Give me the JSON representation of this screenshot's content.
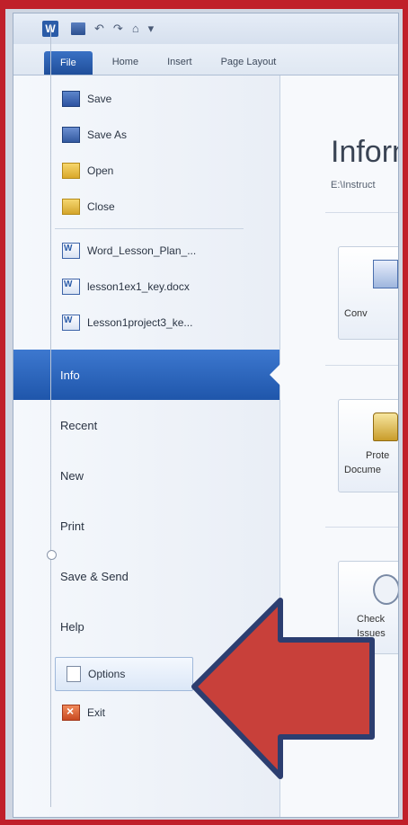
{
  "ribbon": {
    "tabs": [
      "File",
      "Home",
      "Insert",
      "Page Layout"
    ]
  },
  "backstage": {
    "commands": [
      {
        "label": "Save",
        "icon": "save-icon"
      },
      {
        "label": "Save As",
        "icon": "save-as-icon"
      },
      {
        "label": "Open",
        "icon": "open-folder-icon"
      },
      {
        "label": "Close",
        "icon": "close-folder-icon"
      }
    ],
    "recent_files": [
      "Word_Lesson_Plan_...",
      "lesson1ex1_key.docx",
      "Lesson1project3_ke..."
    ],
    "tabs": [
      "Info",
      "Recent",
      "New",
      "Print",
      "Save & Send",
      "Help"
    ],
    "active_tab": "Info",
    "options_label": "Options",
    "exit_label": "Exit"
  },
  "content": {
    "title": "Inform",
    "path": "E:\\Instruct",
    "buttons": [
      {
        "line1": "Conv",
        "line2": "",
        "icon": "convert-icon"
      },
      {
        "line1": "Prote",
        "line2": "Docume",
        "icon": "protect-document-icon"
      },
      {
        "line1": "Check",
        "line2": "Issues",
        "icon": "check-issues-icon"
      }
    ]
  },
  "colors": {
    "frame": "#c0202a",
    "file_tab": "#2a5fb4",
    "active_nav": "#2c63ba",
    "arrow_fill": "#c8403a",
    "arrow_stroke": "#2c3e70"
  }
}
